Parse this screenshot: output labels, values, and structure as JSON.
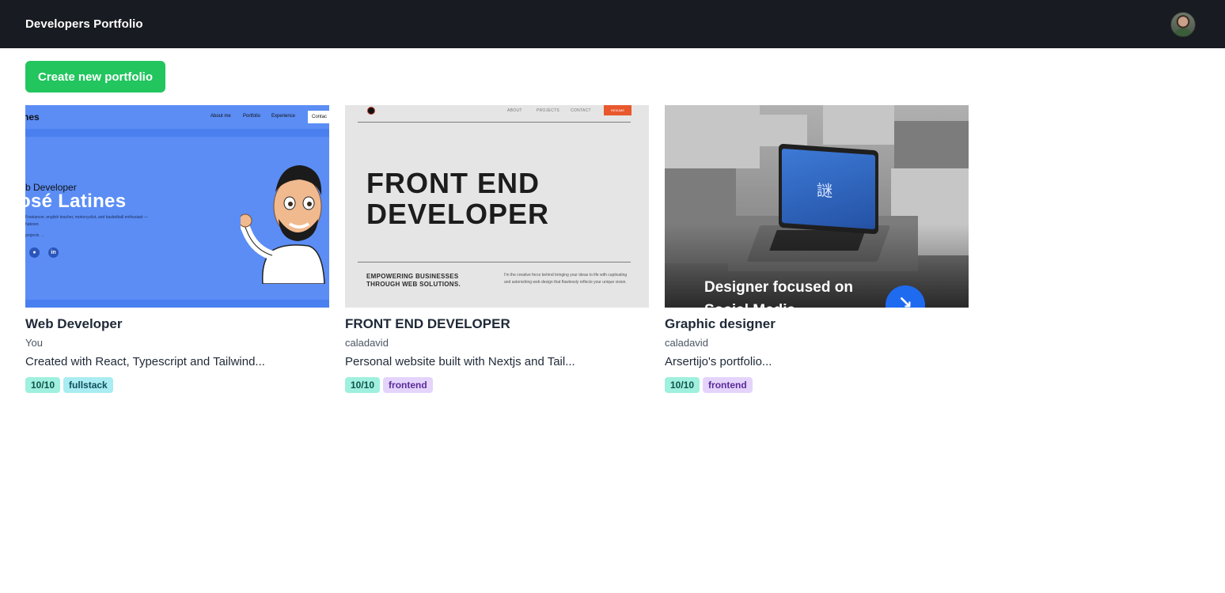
{
  "navbar": {
    "title": "Developers Portfolio"
  },
  "actions": {
    "create_label": "Create new portfolio"
  },
  "cards": [
    {
      "title": "Web Developer",
      "author": "You",
      "description": "Created with React, Typescript and Tailwind...",
      "score": "10/10",
      "category": "fullstack",
      "preview": {
        "logo": "nes",
        "menu": [
          "About me",
          "Portfolio",
          "Experience"
        ],
        "contact": "Contac",
        "subtitle": "b Developer",
        "name": "osé Latines",
        "blurb": "Freelancer, english teacher, motorcyclist, and basketball enthusiast —",
        "blurb2": "hatever.",
        "link": "projects →",
        "social": [
          "github-icon",
          "linkedin-icon"
        ]
      }
    },
    {
      "title": "FRONT END DEVELOPER",
      "author": "caladavid",
      "description": "Personal website built with Nextjs and Tail...",
      "score": "10/10",
      "category": "frontend",
      "preview": {
        "menu": [
          "ABOUT",
          "PROJECTS",
          "CONTACT"
        ],
        "resume": "RESUME",
        "hero_line1": "FRONT END",
        "hero_line2": "DEVELOPER",
        "tagline_line1": "EMPOWERING BUSINESSES",
        "tagline_line2": "THROUGH WEB SOLUTIONS.",
        "paragraph": "I'm the creative force behind bringing your ideas to life with captivating and astonishing web design that flawlessly reflects your unique vision."
      }
    },
    {
      "title": "Graphic designer",
      "author": "caladavid",
      "description": "Arsertijo's portfolio...",
      "score": "10/10",
      "category": "frontend",
      "preview": {
        "caption": "Designer focused on Social Media",
        "screen_glyph": "謎",
        "arrow": "↘"
      }
    }
  ]
}
